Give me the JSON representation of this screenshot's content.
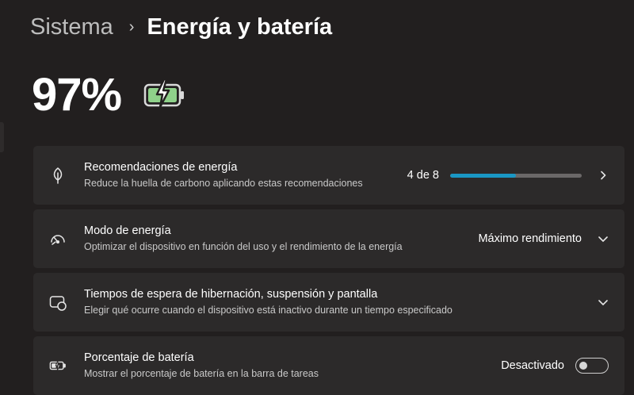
{
  "breadcrumb": {
    "parent": "Sistema",
    "separator": "›",
    "current": "Energía y batería"
  },
  "battery": {
    "percent": "97%",
    "icon": "battery-charging-icon",
    "icon_color": "#8fd18a"
  },
  "cards": [
    {
      "icon": "leaf-icon",
      "title": "Recomendaciones de energía",
      "subtitle": "Reduce la huella de carbono aplicando estas recomendaciones",
      "value": "4 de 8",
      "progress": 0.5,
      "progress_color": "#1a97c4",
      "action_icon": "chevron-right-icon"
    },
    {
      "icon": "gauge-icon",
      "title": "Modo de energía",
      "subtitle": "Optimizar el dispositivo en función del uso y el rendimiento de la energía",
      "value": "Máximo rendimiento",
      "action_icon": "chevron-down-icon"
    },
    {
      "icon": "screen-sleep-icon",
      "title": "Tiempos de espera de hibernación, suspensión y pantalla",
      "subtitle": "Elegir qué ocurre cuando el dispositivo está inactivo durante un tiempo especificado",
      "action_icon": "chevron-down-icon"
    },
    {
      "icon": "battery-percent-icon",
      "title": "Porcentaje de batería",
      "subtitle": "Mostrar el porcentaje de batería en la barra de tareas",
      "value": "Desactivado",
      "toggle_on": false
    }
  ]
}
